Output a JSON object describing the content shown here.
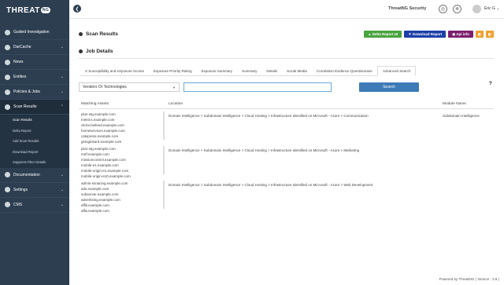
{
  "sidebar": {
    "logo_text": "THREAT",
    "logo_badge": "NG",
    "items": [
      {
        "label": "Guided Investigation",
        "icon": "circle-icon",
        "chevron": ""
      },
      {
        "label": "DarCache",
        "icon": "cache-icon",
        "chevron": "⌄"
      },
      {
        "label": "News",
        "icon": "news-icon",
        "chevron": ""
      },
      {
        "label": "Entities",
        "icon": "entities-icon",
        "chevron": "⌄"
      },
      {
        "label": "Policies & Jobs",
        "icon": "policies-icon",
        "chevron": "⌄"
      },
      {
        "label": "Scan Results",
        "icon": "scan-icon",
        "chevron": "⌃"
      }
    ],
    "sub_items": [
      "Scan Results",
      "Delta Report",
      "Add Scan Results",
      "Download Report",
      "Suppress Filter Details"
    ],
    "bottom_items": [
      {
        "label": "Documentation",
        "icon": "doc-icon",
        "chevron": "⌄"
      },
      {
        "label": "Settings",
        "icon": "gear-icon",
        "chevron": "⌄"
      },
      {
        "label": "CMS",
        "icon": "cms-icon",
        "chevron": "⌄"
      }
    ]
  },
  "header": {
    "back_glyph": "❮",
    "brand": "ThreatNG Security",
    "user": "Eric G ⌄"
  },
  "main": {
    "page_title": "Scan Results",
    "actions": {
      "delta": "▲ Delta Report UI",
      "download": "▼ Download Report",
      "api": "◉ Api info",
      "o1": "◧",
      "o2": "◧"
    },
    "section_title": "Job Details",
    "tabs": [
      "X Susceptibility and eXposure Scores",
      "Exposure Priority Rating",
      "Exposure Summary",
      "Summary",
      "Details",
      "Social Media",
      "Correlation Evidence Questionnaire",
      "Advanced Search"
    ],
    "select_value": "Vendors Or Technologies",
    "search_value": "",
    "search_button": "Search",
    "help": "?",
    "columns": {
      "assets": "Matching Assets",
      "location": "Location",
      "module": "Module Name"
    },
    "rows": [
      {
        "assets": [
          "plus-stg.example.com",
          "metrics.example.com",
          "clicks.bwfeed.example.com",
          "homeservices.example.com",
          "catspress.example.com",
          "geloginkard.example.com"
        ],
        "location": "Domain Intelligence > Subdomain Intelligence > Cloud Hosting > Infrastructure Identified on Microsoft - Azure > Communication",
        "module": "Subdomain Intelligence"
      },
      {
        "assets": [
          "plus-stg.example.com",
          "mrtf.example.com",
          "missioncontrol.example.com",
          "mobile-e1.example.com",
          "mobile-origin-e1.example.com",
          "mobile-origin-e10.example.com"
        ],
        "location": "Domain Intelligence > Subdomain Intelligence > Cloud Hosting > Infrastructure Identified on Microsoft - Azure > Marketing",
        "module": ""
      },
      {
        "assets": [
          "admin-ssoacing.example.com",
          "ads.example.com",
          "subserver.example.com",
          "advertising.example.com",
          "affili.example.com",
          "affw.example.com"
        ],
        "location": "Domain Intelligence > Subdomain Intelligence > Cloud Hosting > Infrastructure Identified on Microsoft - Azure > Web Development",
        "module": ""
      }
    ]
  },
  "footer": "Powered by ThreatNG ( Version : 3.9 )"
}
